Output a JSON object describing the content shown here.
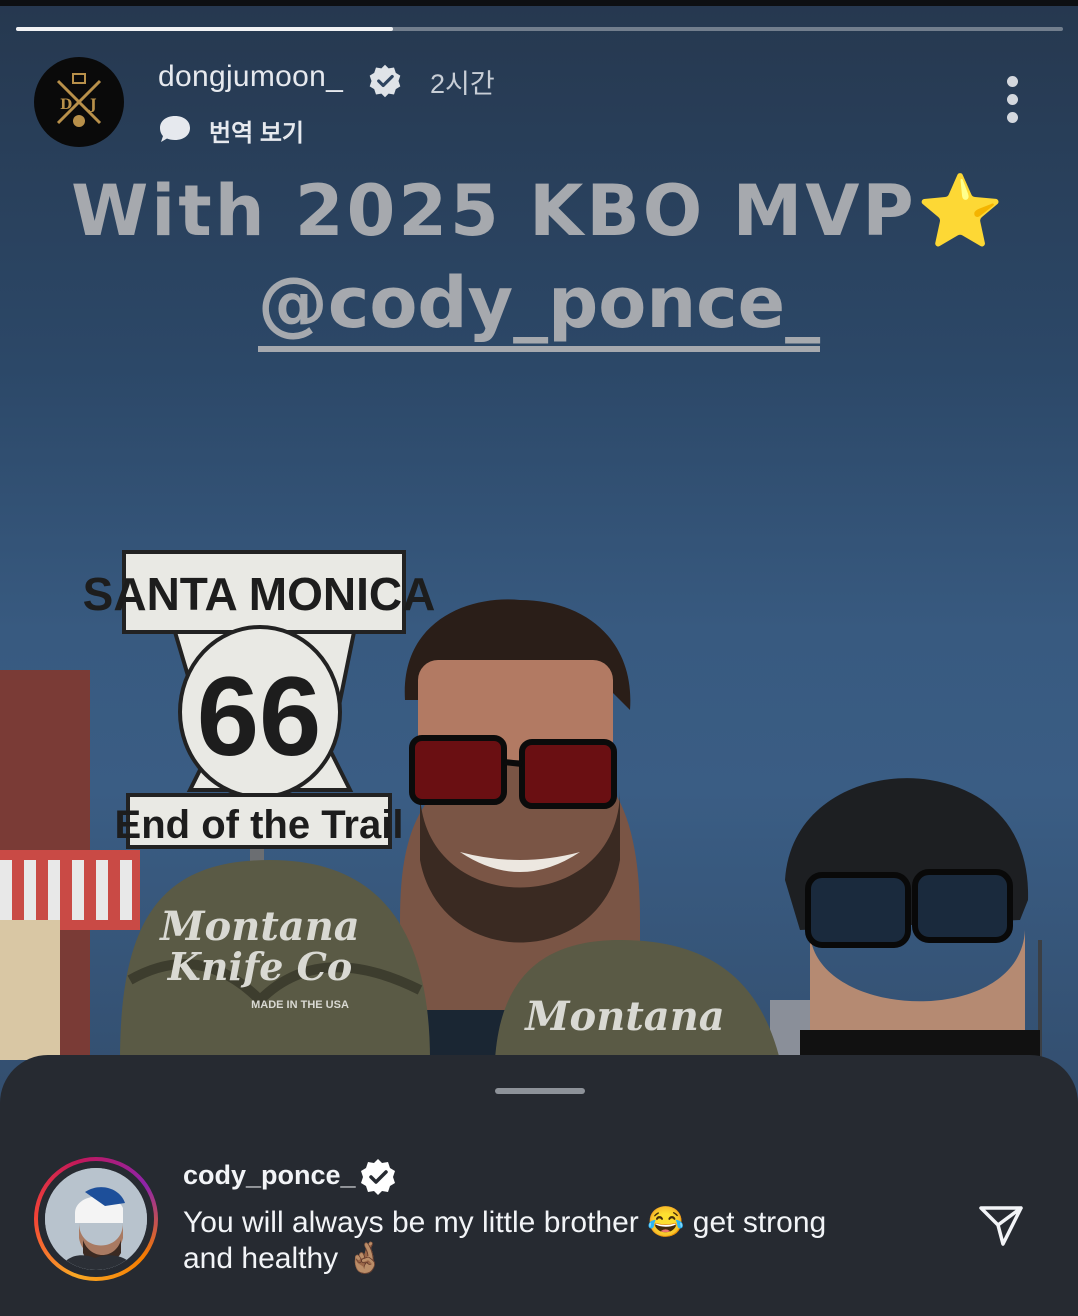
{
  "story": {
    "username": "dongjumoon_",
    "time": "2시간",
    "translate_label": "번역 보기"
  },
  "caption": {
    "line1": "With 2025 KBO MVP",
    "line1_emoji": "⭐",
    "mention": "@cody_ponce_"
  },
  "photo_signs": {
    "sign_top": "SANTA MONICA",
    "sign_number": "66",
    "sign_bottom": "End of the Trail",
    "hat_text_1": "Montana",
    "hat_text_2": "Knife Co",
    "hat_made": "MADE IN THE USA"
  },
  "reply": {
    "username": "cody_ponce_",
    "text_line1": "You will always be my little brother 😂 get strong",
    "text_line2": "and healthy 🤞🏽"
  },
  "icons": {
    "verified": "verified-badge-icon",
    "more": "more-vertical-icon",
    "translate": "speech-bubble-icon",
    "send": "paper-plane-icon"
  },
  "colors": {
    "verified_badge": "#ffffff",
    "story_ring": "#f44336",
    "star": "#e8b43a"
  },
  "progress": {
    "fraction": 0.36
  }
}
